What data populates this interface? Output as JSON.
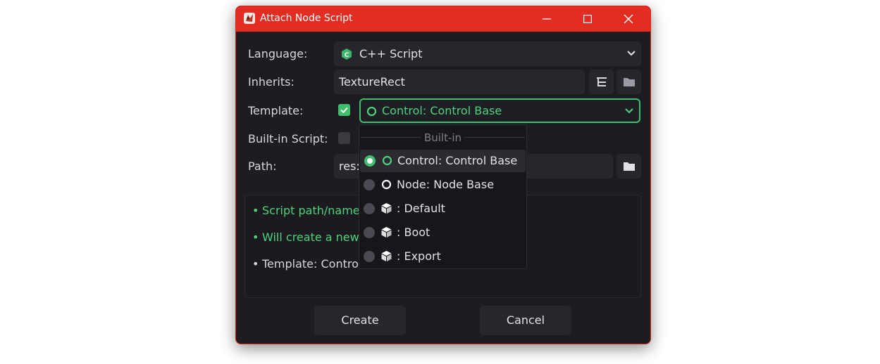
{
  "window": {
    "title": "Attach Node Script",
    "colors": {
      "titlebar": "#e32d22",
      "background": "#1c1c21",
      "accent_green": "#3fbf6e"
    }
  },
  "form": {
    "language": {
      "label": "Language:",
      "value": "C++ Script",
      "icon": "cpp-script-icon"
    },
    "inherits": {
      "label": "Inherits:",
      "value": "TextureRect"
    },
    "template": {
      "label": "Template:",
      "checked": true,
      "value": "Control: Control Base"
    },
    "builtin": {
      "label": "Built-in Script:",
      "checked": false
    },
    "path": {
      "label": "Path:",
      "value": "res:"
    }
  },
  "info": [
    {
      "text": "Script path/name",
      "color": "#4fd27d"
    },
    {
      "text": "Will create a new",
      "color": "#4fd27d"
    },
    {
      "text": "Template: Contro",
      "color": "#d8d8dc"
    }
  ],
  "buttons": {
    "create": "Create",
    "cancel": "Cancel"
  },
  "dropdown": {
    "header": "Built-in",
    "options": [
      {
        "label": "Control: Control Base",
        "icon": "circle-icon",
        "selected": true
      },
      {
        "label": "Node: Node Base",
        "icon": "circle-icon",
        "selected": false
      },
      {
        "label": ": Default",
        "icon": "cube-icon",
        "selected": false
      },
      {
        "label": ": Boot",
        "icon": "cube-icon",
        "selected": false
      },
      {
        "label": ": Export",
        "icon": "cube-icon",
        "selected": false
      }
    ]
  }
}
